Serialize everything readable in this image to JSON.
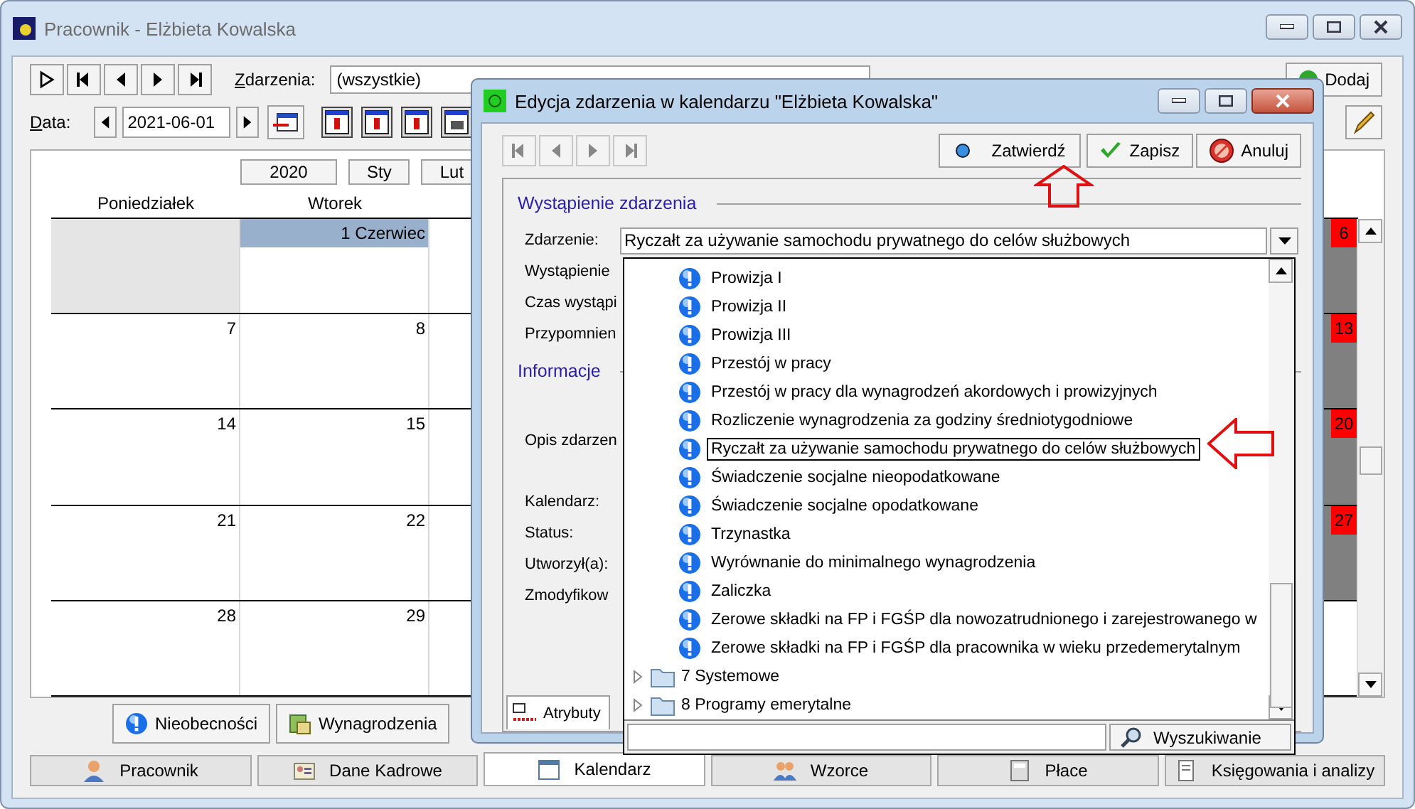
{
  "window": {
    "title": "Pracownik - Elżbieta Kowalska"
  },
  "filter": {
    "label": "Zdarzenia:",
    "value": "(wszystkie)"
  },
  "add_button": "Dodaj",
  "date": {
    "label": "Data:",
    "value": "2021-06-01"
  },
  "calendar": {
    "year": "2020",
    "months": [
      "Sty",
      "Lut"
    ],
    "weekdays": [
      "Poniedziałek",
      "Wtorek"
    ],
    "weeks": [
      {
        "days": [
          {
            "kind": "outside"
          },
          {
            "kind": "month-start",
            "label": "1 Czerwiec"
          }
        ],
        "sunday": "6"
      },
      {
        "days": [
          {
            "kind": "day",
            "label": "7"
          },
          {
            "kind": "day",
            "label": "8"
          }
        ],
        "sunday": "13"
      },
      {
        "days": [
          {
            "kind": "day",
            "label": "14"
          },
          {
            "kind": "day",
            "label": "15"
          }
        ],
        "sunday": "20"
      },
      {
        "days": [
          {
            "kind": "day",
            "label": "21"
          },
          {
            "kind": "day",
            "label": "22"
          }
        ],
        "sunday": "27"
      },
      {
        "days": [
          {
            "kind": "day",
            "label": "28"
          },
          {
            "kind": "day",
            "label": "29"
          }
        ]
      }
    ]
  },
  "section_buttons": [
    {
      "label": "Nieobecności",
      "kind": "absence"
    },
    {
      "label": "Wynagrodzenia",
      "kind": "salary"
    }
  ],
  "tabs": [
    {
      "label": "Pracownik",
      "selected": false
    },
    {
      "label": "Dane Kadrowe",
      "selected": false
    },
    {
      "label": "Kalendarz",
      "selected": true
    },
    {
      "label": "Wzorce",
      "selected": false
    },
    {
      "label": "Płace",
      "selected": false
    },
    {
      "label": "Księgowania i analizy",
      "selected": false
    }
  ],
  "dialog": {
    "title": "Edycja zdarzenia w kalendarzu \"Elżbieta Kowalska\"",
    "buttons": [
      {
        "label": "Zatwierdź",
        "kind": "confirm"
      },
      {
        "label": "Zapisz",
        "kind": "save"
      },
      {
        "label": "Anuluj",
        "kind": "cancel"
      }
    ],
    "sections": [
      {
        "title": "Wystąpienie zdarzenia",
        "fields": [
          {
            "label": "Zdarzenie:",
            "value": "Ryczałt za używanie samochodu prywatnego do celów służbowych"
          },
          {
            "label": "Wystąpienie"
          },
          {
            "label": "Czas wystąpi"
          },
          {
            "label": "Przypomnien"
          }
        ]
      },
      {
        "title": "Informacje",
        "fields": [
          {
            "label": "Opis zdarzen",
            "kind": "multiline"
          },
          {
            "label": "Kalendarz:"
          },
          {
            "label": "Status:"
          },
          {
            "label": "Utworzył(a):"
          },
          {
            "label": "Zmodyfikow"
          }
        ]
      }
    ],
    "tab": "Atrybuty"
  },
  "dropdown": {
    "items": [
      {
        "kind": "event",
        "label": "Prowizja I",
        "selected": false
      },
      {
        "kind": "event",
        "label": "Prowizja II",
        "selected": false
      },
      {
        "kind": "event",
        "label": "Prowizja III",
        "selected": false
      },
      {
        "kind": "event",
        "label": "Przestój w pracy",
        "selected": false
      },
      {
        "kind": "event",
        "label": "Przestój w pracy dla wynagrodzeń akordowych i prowizyjnych",
        "selected": false
      },
      {
        "kind": "event",
        "label": "Rozliczenie wynagrodzenia za godziny średniotygodniowe",
        "selected": false
      },
      {
        "kind": "event",
        "label": "Ryczałt za używanie samochodu prywatnego do celów służbowych",
        "selected": true
      },
      {
        "kind": "event",
        "label": "Świadczenie socjalne nieopodatkowane",
        "selected": false
      },
      {
        "kind": "event",
        "label": "Świadczenie socjalne opodatkowane",
        "selected": false
      },
      {
        "kind": "event",
        "label": "Trzynastka",
        "selected": false
      },
      {
        "kind": "event",
        "label": "Wyrównanie do minimalnego wynagrodzenia",
        "selected": false
      },
      {
        "kind": "event",
        "label": "Zaliczka",
        "selected": false
      },
      {
        "kind": "event",
        "label": "Zerowe składki na FP i FGŚP dla nowozatrudnionego i zarejestrowanego w",
        "selected": false
      },
      {
        "kind": "event",
        "label": "Zerowe składki na FP i FGŚP dla pracownika w wieku przedemerytalnym",
        "selected": false
      },
      {
        "kind": "folder",
        "label": "7 Systemowe",
        "expanded": false
      },
      {
        "kind": "folder",
        "label": "8 Programy emerytalne",
        "expanded": false
      }
    ],
    "search_button": "Wyszukiwanie"
  }
}
